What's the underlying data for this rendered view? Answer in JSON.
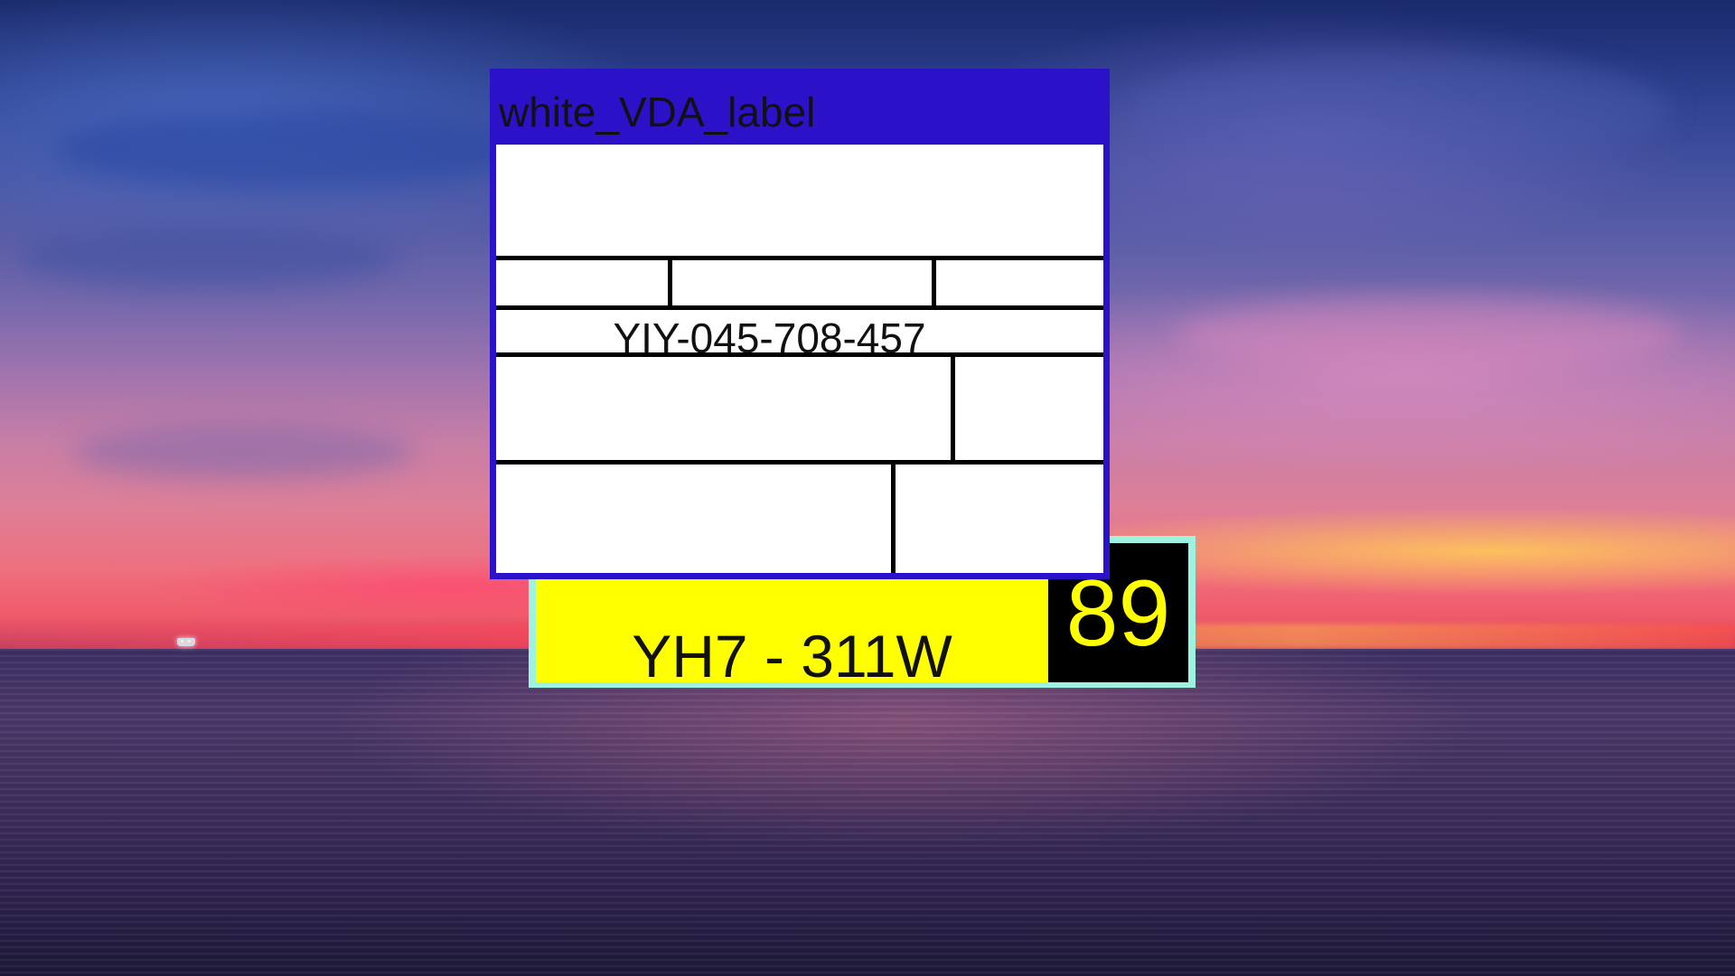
{
  "desktop": {
    "wallpaper": "sunset-sea"
  },
  "vda_window": {
    "title": "white_VDA_label",
    "id_code": "YIY-045-708-457",
    "title_bar_color": "#2b12c8"
  },
  "plate": {
    "code": "YH7 - 311W",
    "number": "89",
    "plate_color": "#ffff00",
    "number_bg": "#000000",
    "border_color": "#9ef2e0"
  }
}
